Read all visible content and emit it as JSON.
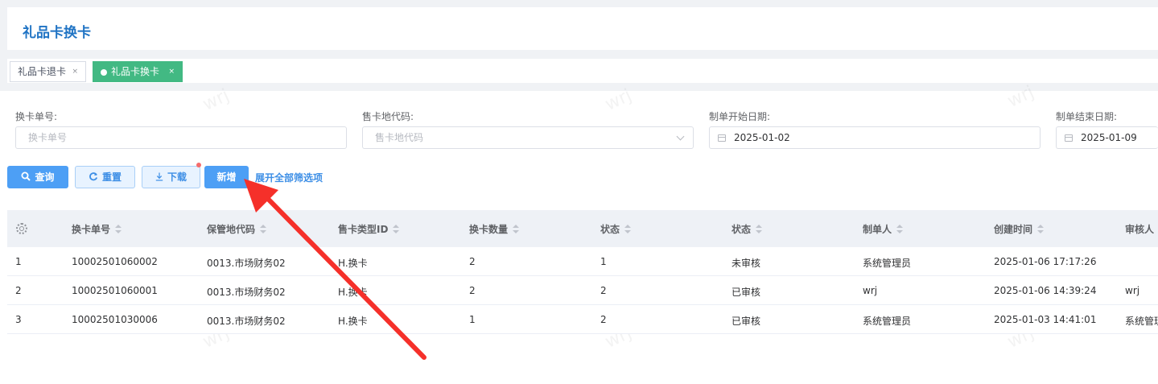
{
  "header": {
    "title": "礼品卡换卡"
  },
  "tabs": [
    {
      "label": "礼品卡退卡",
      "close": "×",
      "active": false
    },
    {
      "label": "礼品卡换卡",
      "close": "×",
      "active": true
    }
  ],
  "filters": {
    "exchange_no": {
      "label": "换卡单号:",
      "placeholder": "换卡单号"
    },
    "sale_location": {
      "label": "售卡地代码:",
      "placeholder": "售卡地代码"
    },
    "start_date": {
      "label": "制单开始日期:",
      "value": "2025-01-02"
    },
    "end_date": {
      "label": "制单结束日期:",
      "value": "2025-01-09"
    }
  },
  "actions": {
    "query": "查询",
    "reset": "重置",
    "download": "下载",
    "add": "新增",
    "expand": "展开全部筛选项"
  },
  "table": {
    "columns": [
      "换卡单号",
      "保管地代码",
      "售卡类型ID",
      "换卡数量",
      "状态",
      "状态",
      "制单人",
      "创建时间",
      "审核人"
    ],
    "rows": [
      {
        "index": "1",
        "no": "10002501060002",
        "location": "0013.市场财务02",
        "type": "H.换卡",
        "qty": "2",
        "status_code": "1",
        "status": "未审核",
        "creator": "系统管理员",
        "created": "2025-01-06 17:17:26",
        "auditor": ""
      },
      {
        "index": "2",
        "no": "10002501060001",
        "location": "0013.市场财务02",
        "type": "H.换卡",
        "qty": "2",
        "status_code": "2",
        "status": "已审核",
        "creator": "wrj",
        "created": "2025-01-06 14:39:24",
        "auditor": "wrj"
      },
      {
        "index": "3",
        "no": "10002501030006",
        "location": "0013.市场财务02",
        "type": "H.换卡",
        "qty": "1",
        "status_code": "2",
        "status": "已审核",
        "creator": "系统管理员",
        "created": "2025-01-03 14:41:01",
        "auditor": "系统管理员"
      }
    ]
  },
  "watermark": "wrj",
  "colors": {
    "primary": "#4d9ff5",
    "tab_active": "#42b983",
    "title": "#1f73c4",
    "annotation_arrow": "#f5302a"
  }
}
